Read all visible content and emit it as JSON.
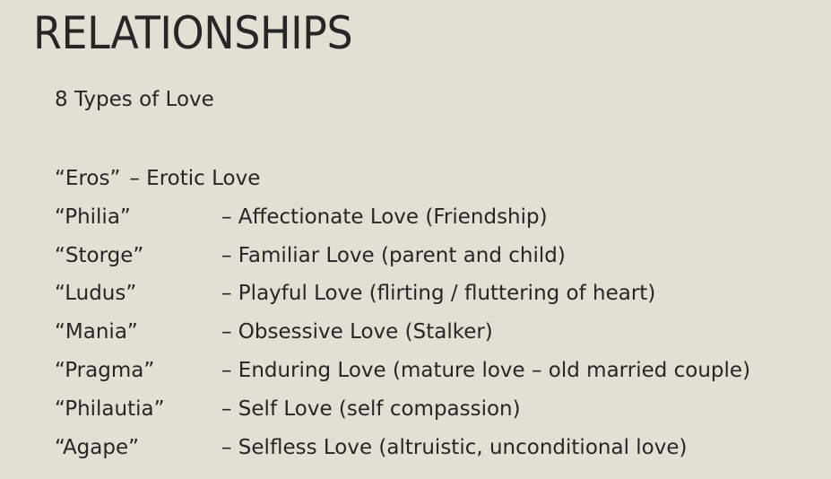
{
  "slide": {
    "title": "RELATIONSHIPS",
    "subtitle": "8 Types of Love",
    "types": [
      {
        "term": "“Eros”",
        "description": "– Erotic Love"
      },
      {
        "term": "“Philia”",
        "description": "– Affectionate Love (Friendship)"
      },
      {
        "term": "“Storge”",
        "description": "– Familiar Love (parent and child)"
      },
      {
        "term": "“Ludus”",
        "description": "– Playful Love (flirting / fluttering of heart)"
      },
      {
        "term": "“Mania”",
        "description": "– Obsessive Love (Stalker)"
      },
      {
        "term": "“Pragma”",
        "description": "– Enduring Love (mature love – old married couple)"
      },
      {
        "term": "“Philautia”",
        "description": "– Self Love (self compassion)"
      },
      {
        "term": "“Agape”",
        "description": "– Selfless Love (altruistic, unconditional love)"
      }
    ]
  },
  "colors": {
    "background": "#e4dfd5",
    "text": "#262626"
  }
}
